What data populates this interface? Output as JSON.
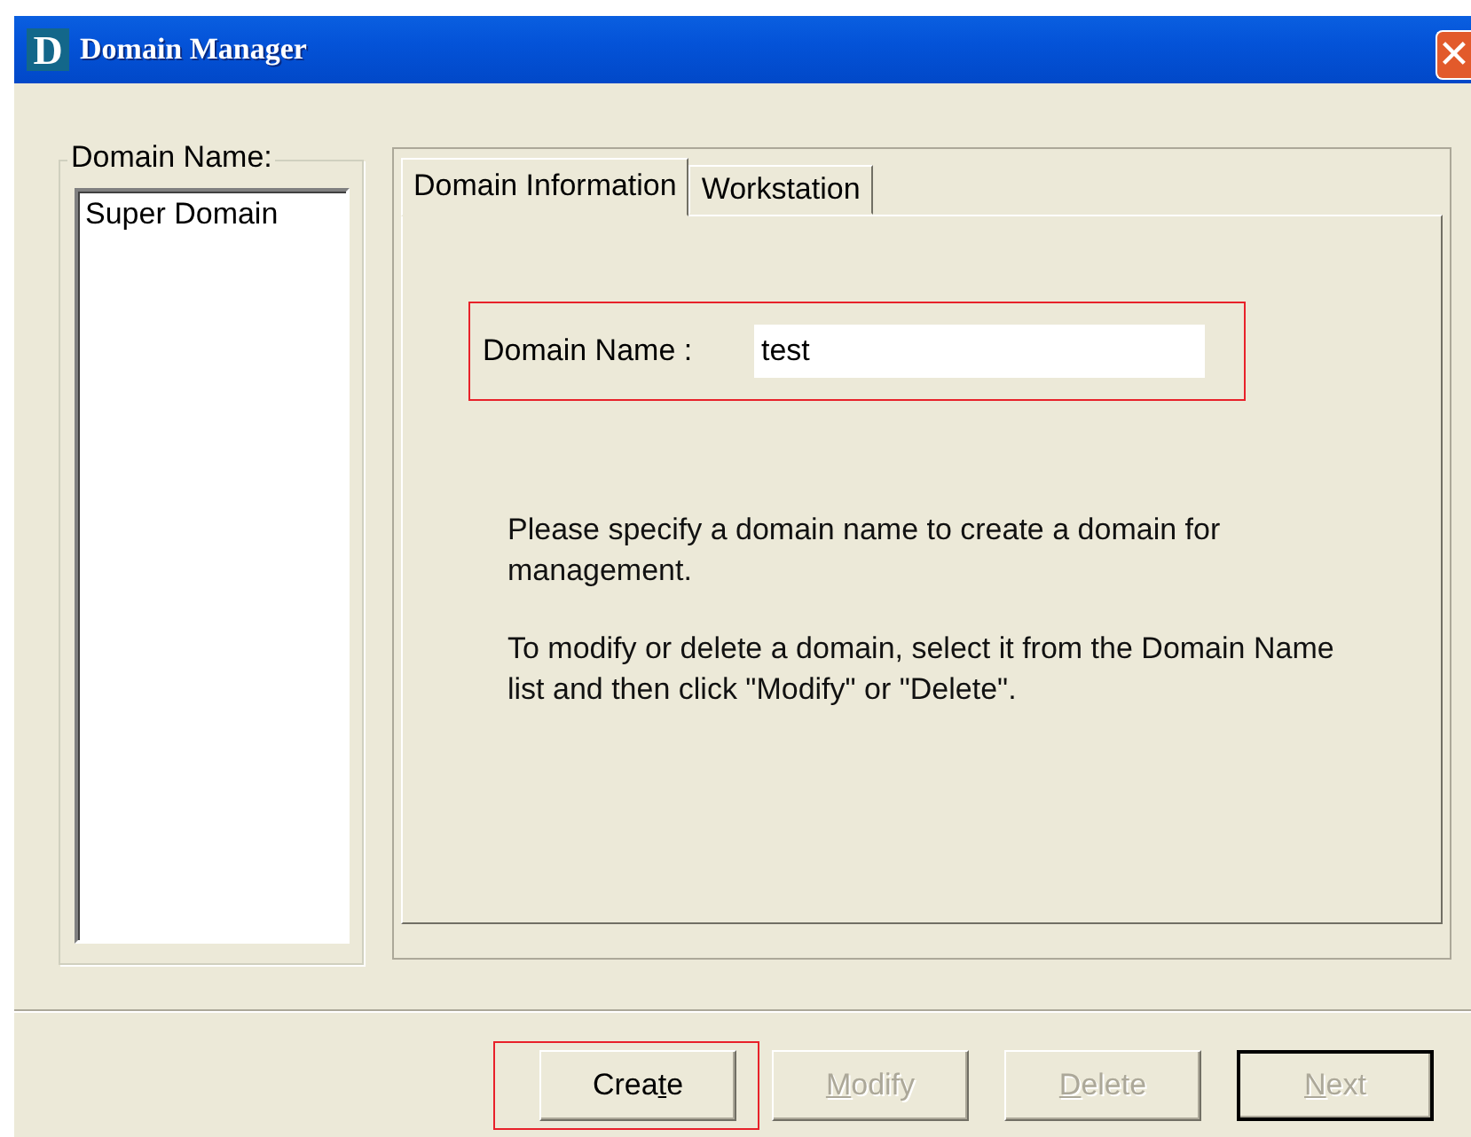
{
  "window": {
    "title": "Domain Manager",
    "logo": "D",
    "close": "✕"
  },
  "domain_list": {
    "legend": "Domain Name:",
    "items": [
      {
        "label": "Super Domain",
        "selected": false
      }
    ]
  },
  "tabs": [
    {
      "label": "Domain Information",
      "selected": true
    },
    {
      "label": "Workstation",
      "selected": false
    }
  ],
  "form": {
    "label": "Domain Name :",
    "value": "test",
    "highlighted": true
  },
  "help": [
    "Please specify a domain name to create a domain for management.",
    "To modify or delete a domain, select it from the Domain Name list and then click \"Modify\" or \"Delete\"."
  ],
  "buttons": [
    {
      "before": "Crea",
      "key": "t",
      "after": "e",
      "disabled": false,
      "default": false,
      "highlighted": true
    },
    {
      "key": "M",
      "after": "odify",
      "disabled": true,
      "default": false,
      "highlighted": false
    },
    {
      "key": "D",
      "after": "elete",
      "disabled": true,
      "default": false,
      "highlighted": false
    },
    {
      "key": "N",
      "after": "ext",
      "disabled": true,
      "default": true,
      "highlighted": false
    }
  ]
}
